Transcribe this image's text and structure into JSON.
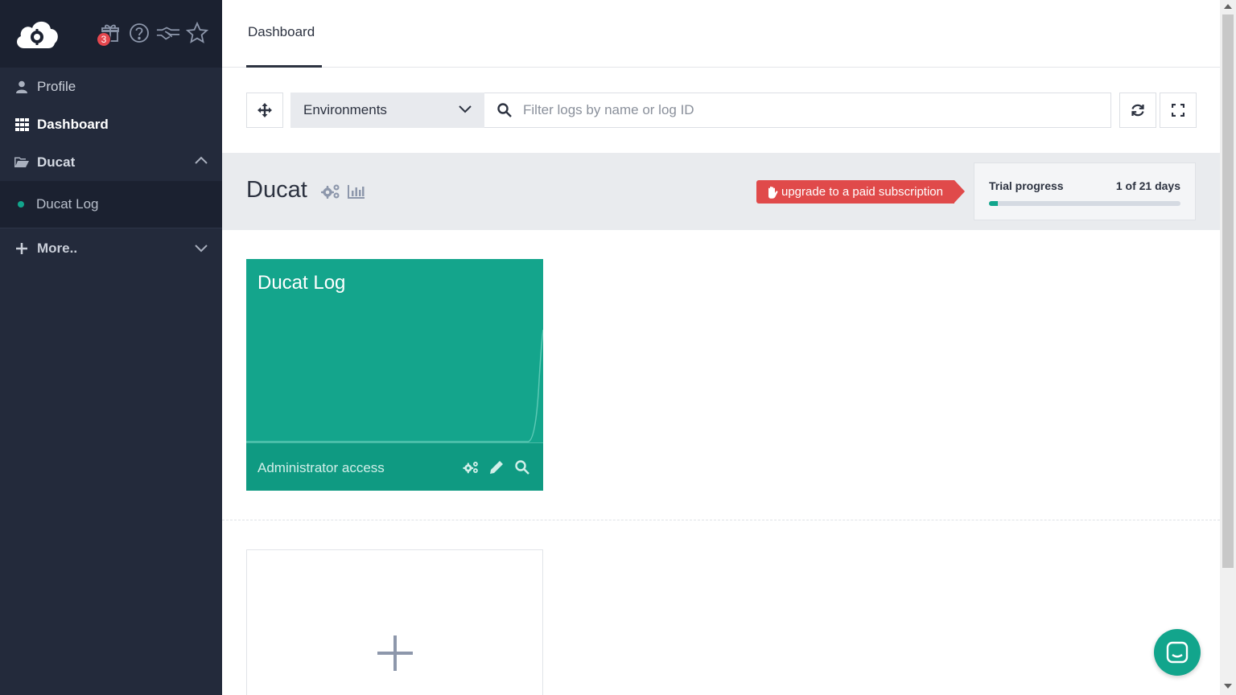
{
  "sidebar": {
    "notification_count": "3",
    "items": [
      {
        "label": "Profile",
        "icon": "user-icon"
      },
      {
        "label": "Dashboard",
        "icon": "grid-icon"
      },
      {
        "label": "Ducat",
        "icon": "folder-open-icon"
      },
      {
        "label": "Ducat Log",
        "icon": "status-dot"
      },
      {
        "label": "More..",
        "icon": "plus-icon"
      }
    ]
  },
  "tabs": [
    {
      "label": "Dashboard"
    }
  ],
  "toolbar": {
    "environment_select": "Environments",
    "search_placeholder": "Filter logs by name or log ID"
  },
  "organization": {
    "name": "Ducat",
    "upgrade_label": "upgrade to a paid subscription",
    "trial": {
      "label": "Trial progress",
      "days": "1 of 21 days",
      "progress": 0.048
    }
  },
  "log_card": {
    "title": "Ducat Log",
    "access": "Administrator access"
  },
  "colors": {
    "sidebar_bg": "#232a3b",
    "accent_teal": "#14a58c",
    "upgrade_red": "#e04a4a",
    "band_gray": "#e9ebee"
  }
}
